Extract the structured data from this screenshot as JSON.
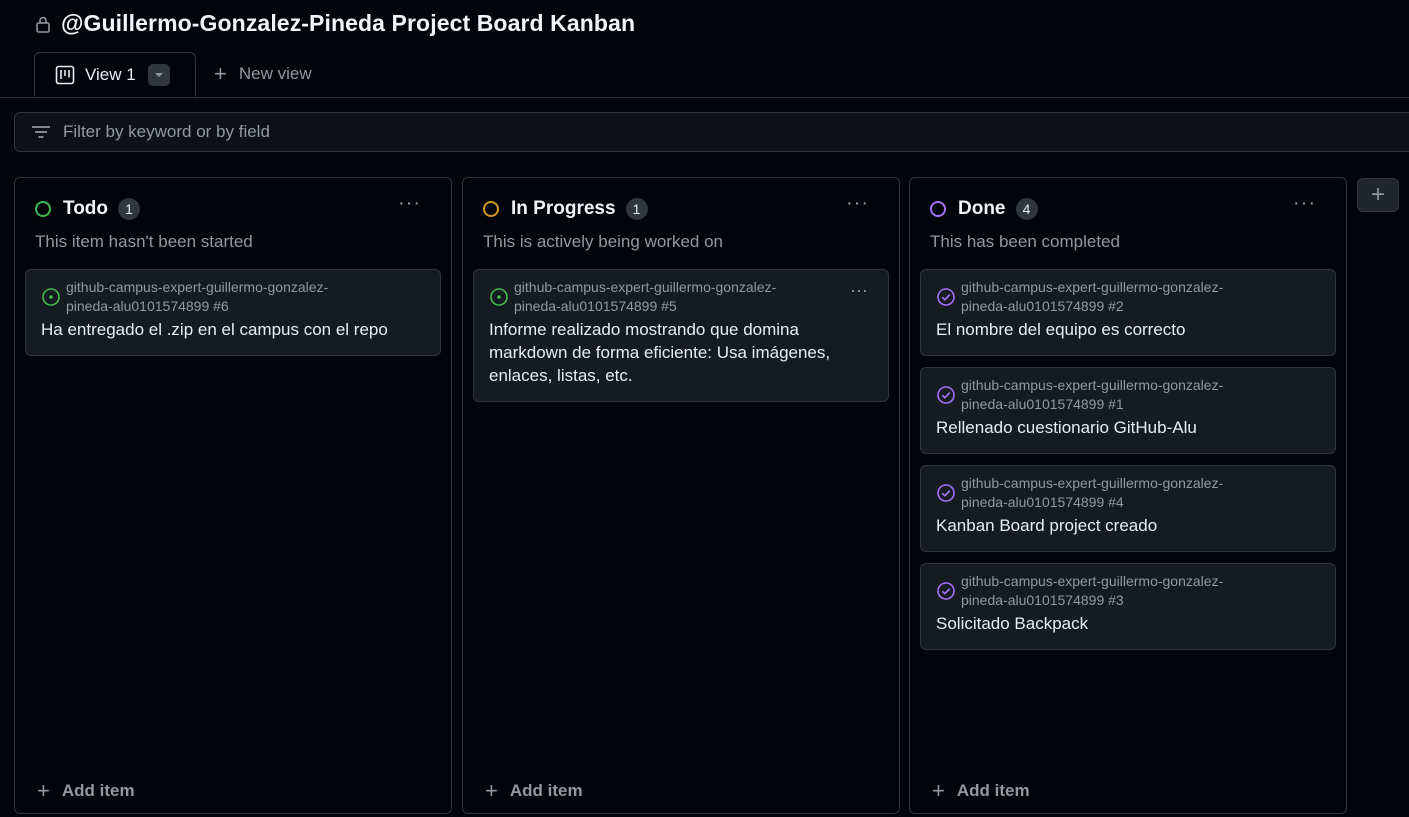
{
  "header": {
    "title": "@Guillermo-Gonzalez-Pineda Project Board Kanban",
    "lock_icon": "lock-icon"
  },
  "tabs": {
    "active_label": "View 1",
    "new_view_label": "New view",
    "plus_glyph": "+"
  },
  "filter": {
    "placeholder": "Filter by keyword or by field"
  },
  "add_column_glyph": "+",
  "menu_glyph": "···",
  "colors": {
    "todo": "#3fb950",
    "in_progress": "#d29922",
    "done": "#a371f7",
    "open_issue": "#3fb950",
    "closed_issue": "#a371f7"
  },
  "columns": [
    {
      "name": "Todo",
      "count": "1",
      "description": "This item hasn't been started",
      "add_label": "Add item",
      "cards": [
        {
          "repo": "github-campus-expert-guillermo-gonzalez-pineda-alu0101574899 #6",
          "title": "Ha entregado el .zip en el campus con el repo",
          "icon": "issue-opened-icon"
        }
      ]
    },
    {
      "name": "In Progress",
      "count": "1",
      "description": "This is actively being worked on",
      "add_label": "Add item",
      "cards": [
        {
          "repo": "github-campus-expert-guillermo-gonzalez-pineda-alu0101574899 #5",
          "title": "Informe realizado mostrando que domina markdown de forma eficiente: Usa imágenes, enlaces, listas, etc.",
          "icon": "issue-opened-icon"
        }
      ]
    },
    {
      "name": "Done",
      "count": "4",
      "description": "This has been completed",
      "add_label": "Add item",
      "cards": [
        {
          "repo": "github-campus-expert-guillermo-gonzalez-pineda-alu0101574899 #2",
          "title": "El nombre del equipo es correcto",
          "icon": "issue-closed-icon"
        },
        {
          "repo": "github-campus-expert-guillermo-gonzalez-pineda-alu0101574899 #1",
          "title": "Rellenado cuestionario GitHub-Alu",
          "icon": "issue-closed-icon"
        },
        {
          "repo": "github-campus-expert-guillermo-gonzalez-pineda-alu0101574899 #4",
          "title": "Kanban Board project creado",
          "icon": "issue-closed-icon"
        },
        {
          "repo": "github-campus-expert-guillermo-gonzalez-pineda-alu0101574899 #3",
          "title": "Solicitado Backpack",
          "icon": "issue-closed-icon"
        }
      ]
    }
  ]
}
